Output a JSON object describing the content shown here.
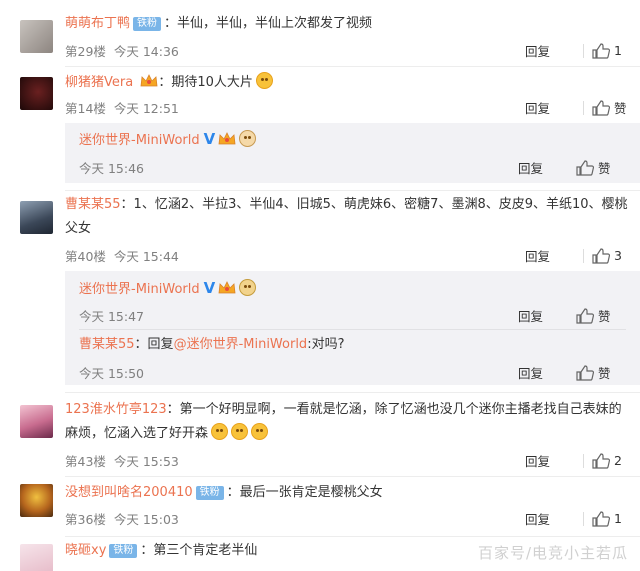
{
  "comments": [
    {
      "user": "萌萌布丁鸭",
      "badge": "铁粉",
      "text": "：半仙，半仙，半仙上次都发了视频",
      "floor": "第29楼",
      "time": "今天 14:36",
      "reply_label": "回复",
      "likes": "1"
    },
    {
      "user": "柳猪猪Vera",
      "text": "：期待10人大片",
      "floor": "第14楼",
      "time": "今天 12:51",
      "reply_label": "回复",
      "like_label": "赞",
      "sub": {
        "user": "迷你世界-MiniWorld",
        "time": "今天 15:46",
        "reply_label": "回复",
        "like_label": "赞"
      }
    },
    {
      "user": "曹某某55",
      "text": "：1、忆涵2、半拉3、半仙4、旧城5、萌虎妹6、密糖7、墨渊8、皮皮9、羊纸10、樱桃父女",
      "floor": "第40楼",
      "time": "今天 15:44",
      "reply_label": "回复",
      "likes": "3",
      "subs": [
        {
          "user": "迷你世界-MiniWorld",
          "time": "今天 15:47",
          "reply_label": "回复",
          "like_label": "赞"
        },
        {
          "user": "曹某某55",
          "text_prefix": "：回复",
          "mention": "@迷你世界-MiniWorld",
          "text_suffix": ":对吗?",
          "time": "今天 15:50",
          "reply_label": "回复",
          "like_label": "赞"
        }
      ]
    },
    {
      "user": "123淮水竹亭123",
      "text": "：第一个好明显啊，一看就是忆涵，除了忆涵也没几个迷你主播老找自己表妹的麻烦，忆涵入选了好开森",
      "floor": "第43楼",
      "time": "今天 15:53",
      "reply_label": "回复",
      "likes": "2"
    },
    {
      "user": "没想到叫啥名200410",
      "badge": "铁粉",
      "text": "：最后一张肯定是樱桃父女",
      "floor": "第36楼",
      "time": "今天 15:03",
      "reply_label": "回复",
      "likes": "1"
    },
    {
      "user": "晓砸xy",
      "badge": "铁粉",
      "text": "：第三个肯定老半仙"
    }
  ],
  "verified_mark": "V",
  "watermark": "百家号/电竞小主若瓜",
  "colors": {
    "username": "#eb7350",
    "verified": "#2d86ea",
    "fans_badge": "#7ab5e8",
    "reply_bg": "#f2f2f5"
  }
}
